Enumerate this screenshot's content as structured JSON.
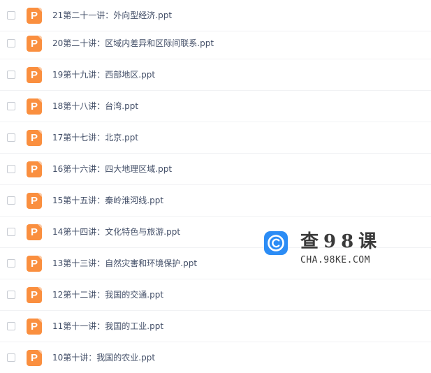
{
  "file_list": {
    "icon": "ppt-file-icon",
    "icon_letter": "P",
    "icon_color": "#fa8f3f",
    "items": [
      {
        "name": "21第二十一讲：外向型经济.ppt"
      },
      {
        "name": "20第二十讲：区域内差异和区际间联系.ppt"
      },
      {
        "name": "19第十九讲：西部地区.ppt"
      },
      {
        "name": "18第十八讲：台湾.ppt"
      },
      {
        "name": "17第十七讲：北京.ppt"
      },
      {
        "name": "16第十六讲：四大地理区域.ppt"
      },
      {
        "name": "15第十五讲：秦岭淮河线.ppt"
      },
      {
        "name": "14第十四讲：文化特色与旅游.ppt"
      },
      {
        "name": "13第十三讲：自然灾害和环境保护.ppt"
      },
      {
        "name": "12第十二讲：我国的交通.ppt"
      },
      {
        "name": "11第十一讲：我国的工业.ppt"
      },
      {
        "name": "10第十讲：我国的农业.ppt"
      }
    ]
  },
  "watermark": {
    "logo_icon": "cha98ke-logo-icon",
    "chinese": "查98课",
    "domain": "CHA.98KE.COM",
    "logo_color": "#2b8cf5"
  }
}
